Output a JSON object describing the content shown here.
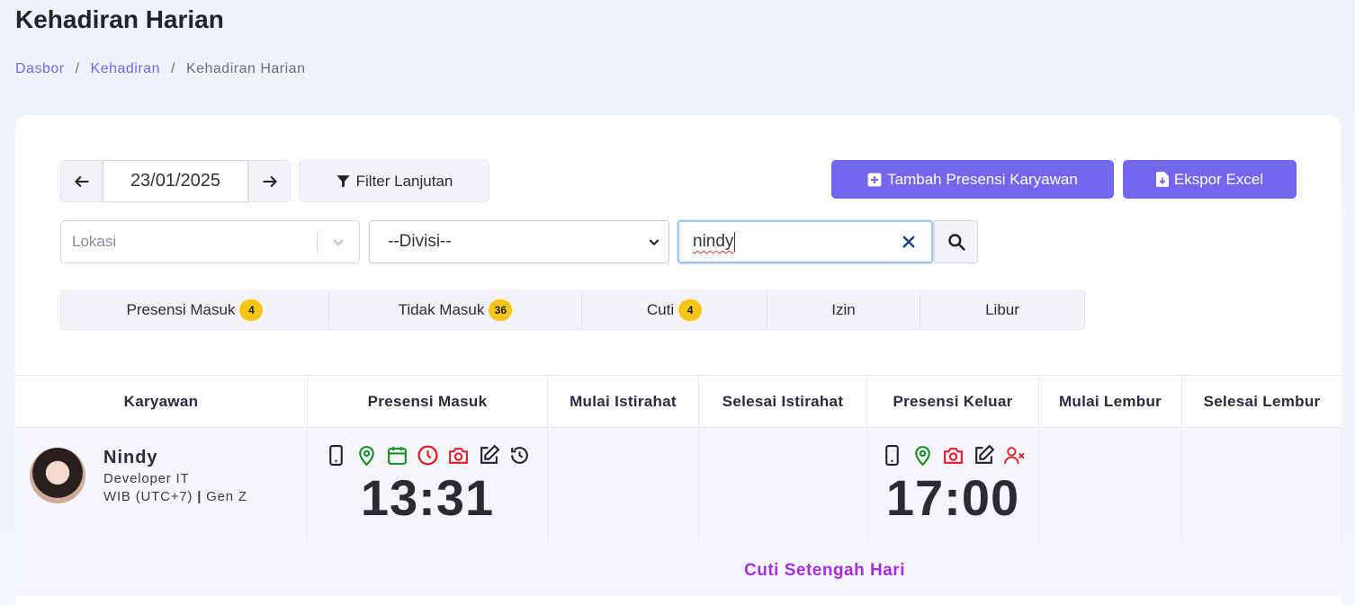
{
  "page": {
    "title": "Kehadiran Harian",
    "breadcrumb": [
      "Dasbor",
      "Kehadiran",
      "Kehadiran Harian"
    ],
    "accent_color": "#7367f0"
  },
  "toolbar": {
    "date": "23/01/2025",
    "filter_label": "Filter Lanjutan",
    "add_label": "Tambah Presensi Karyawan",
    "export_label": "Ekspor Excel"
  },
  "filters": {
    "lokasi_placeholder": "Lokasi",
    "divisi_selected": "--Divisi--",
    "search_value": "nindy"
  },
  "tabs": [
    {
      "label": "Presensi Masuk",
      "count": "4"
    },
    {
      "label": "Tidak Masuk",
      "count": "36"
    },
    {
      "label": "Cuti",
      "count": "4"
    },
    {
      "label": "Izin",
      "count": ""
    },
    {
      "label": "Libur",
      "count": ""
    }
  ],
  "table": {
    "headers": [
      "Karyawan",
      "Presensi Masuk",
      "Mulai Istirahat",
      "Selesai Istirahat",
      "Presensi Keluar",
      "Mulai Lembur",
      "Selesai Lembur"
    ],
    "rows": [
      {
        "name": "Nindy",
        "position": "Developer IT",
        "timezone": "WIB (UTC+7)",
        "group": "Gen Z",
        "check_in_time": "13:31",
        "check_in_icons": [
          "phone-icon",
          "location-pin-icon",
          "calendar-icon",
          "clock-icon",
          "camera-icon",
          "edit-icon",
          "history-icon"
        ],
        "check_out_time": "17:00",
        "check_out_icons": [
          "phone-icon",
          "location-pin-icon",
          "camera-icon",
          "edit-icon",
          "user-x-icon"
        ],
        "note": "Cuti Setengah Hari"
      }
    ]
  }
}
